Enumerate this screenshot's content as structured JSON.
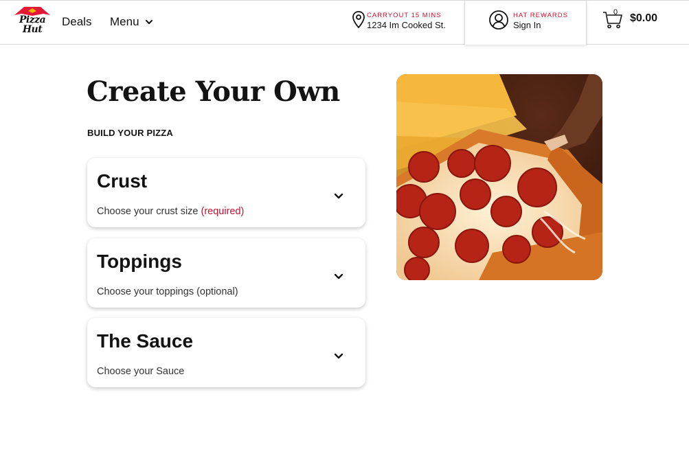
{
  "header": {
    "logo": {
      "line1": "Pizza",
      "line2": "Hut",
      "roof_color": "#e31837"
    },
    "nav": {
      "deals": "Deals",
      "menu": "Menu"
    },
    "carryout": {
      "label": "CARRYOUT 15 MINS",
      "address": "1234 Im Cooked St."
    },
    "rewards": {
      "label": "HAT REWARDS",
      "sign_in": "Sign In"
    },
    "cart": {
      "count": "0",
      "total": "$0.00"
    }
  },
  "main": {
    "title": "Create Your Own",
    "subhead": "BUILD YOUR PIZZA",
    "sections": [
      {
        "title": "Crust",
        "desc": "Choose your crust size",
        "tag": "(required)"
      },
      {
        "title": "Toppings",
        "desc": "Choose your toppings (optional)",
        "tag": ""
      },
      {
        "title": "The Sauce",
        "desc": "Choose your Sauce",
        "tag": ""
      }
    ],
    "hero_image": "pepperoni-pizza-slice-photo"
  },
  "colors": {
    "brand_red": "#c8102e",
    "text": "#131313"
  },
  "icons": [
    "location-pin-icon",
    "user-circle-icon",
    "shopping-cart-icon",
    "chevron-down-icon"
  ]
}
